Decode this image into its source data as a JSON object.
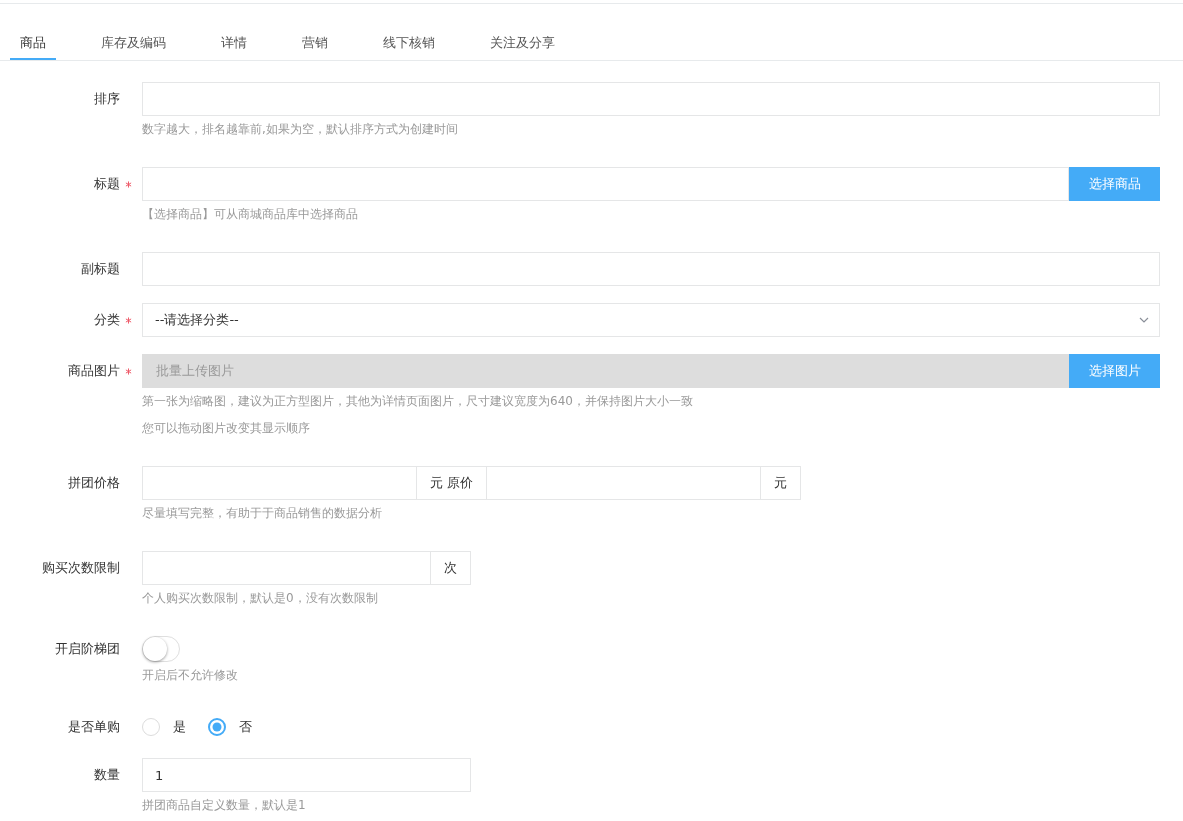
{
  "tabs": [
    {
      "label": "商品",
      "selected": true
    },
    {
      "label": "库存及编码",
      "selected": false
    },
    {
      "label": "详情",
      "selected": false
    },
    {
      "label": "营销",
      "selected": false
    },
    {
      "label": "线下核销",
      "selected": false
    },
    {
      "label": "关注及分享",
      "selected": false
    }
  ],
  "fields": [
    {
      "kind": "text",
      "label": "排序",
      "required": false,
      "help": [
        "数字越大，排名越靠前,如果为空，默认排序方式为创建时间"
      ]
    },
    {
      "kind": "text",
      "label": "标题",
      "required": true,
      "button": "选择商品",
      "help": [
        "【选择商品】可从商城商品库中选择商品"
      ]
    },
    {
      "kind": "text",
      "label": "副标题",
      "required": false
    },
    {
      "kind": "select",
      "label": "分类",
      "required": true,
      "value": "--请选择分类--"
    },
    {
      "kind": "upload",
      "label": "商品图片",
      "required": true,
      "placeholder": "批量上传图片",
      "button": "选择图片",
      "help": [
        "第一张为缩略图，建议为正方型图片，其他为详情页面图片，尺寸建议宽度为640，并保持图片大小一致",
        "您可以拖动图片改变其显示顺序"
      ]
    },
    {
      "kind": "input-group",
      "label": "拼团价格",
      "required": false,
      "parts": [
        {
          "kind": "input"
        },
        {
          "kind": "addon",
          "text": "元 原价"
        },
        {
          "kind": "input"
        },
        {
          "kind": "addon",
          "text": "元"
        }
      ],
      "help": [
        "尽量填写完整，有助于于商品销售的数据分析"
      ]
    },
    {
      "kind": "input-group",
      "label": "购买次数限制",
      "required": false,
      "parts": [
        {
          "kind": "input"
        },
        {
          "kind": "addon",
          "text": "次"
        }
      ],
      "help": [
        "个人购买次数限制，默认是0，没有次数限制"
      ]
    },
    {
      "kind": "switch",
      "label": "开启阶梯团",
      "required": false,
      "on": false,
      "help": [
        "开启后不允许修改"
      ]
    },
    {
      "kind": "radio",
      "label": "是否单购",
      "required": false,
      "options": [
        {
          "label": "是",
          "selected": false
        },
        {
          "label": "否",
          "selected": true
        }
      ]
    },
    {
      "kind": "short-text",
      "label": "数量",
      "required": false,
      "value": "1",
      "help": [
        "拼团商品自定义数量，默认是1"
      ]
    }
  ]
}
